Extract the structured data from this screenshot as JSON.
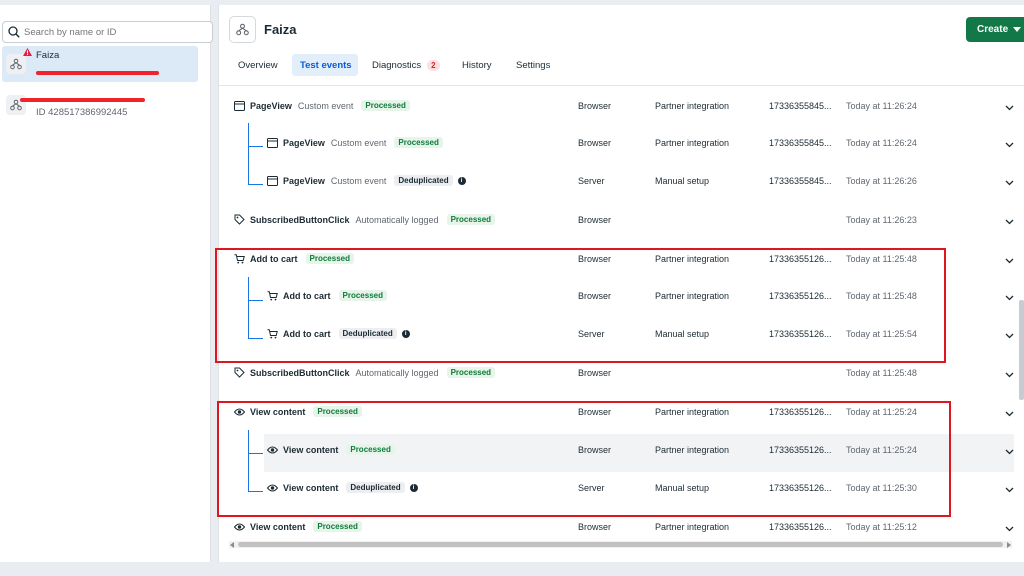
{
  "search": {
    "placeholder": "Search by name or ID"
  },
  "accounts": [
    {
      "name": "Faiza",
      "selected": true,
      "warning": true
    },
    {
      "name": "",
      "id_line": "ID 428517386992445",
      "selected": false
    }
  ],
  "header": {
    "title": "Faiza",
    "create_label": "Create"
  },
  "tabs": [
    {
      "label": "Overview",
      "active": false
    },
    {
      "label": "Test events",
      "active": true
    },
    {
      "label": "Diagnostics",
      "active": false,
      "count": "2"
    },
    {
      "label": "History",
      "active": false
    },
    {
      "label": "Settings",
      "active": false
    }
  ],
  "events": [
    {
      "icon": "browser-window-icon",
      "name": "PageView",
      "type": "Custom event",
      "status": "Processed",
      "source": "Browser",
      "setup": "Partner integration",
      "event_id": "17336355845...",
      "time": "Today at 11:26:24",
      "child": false
    },
    {
      "icon": "browser-window-icon",
      "name": "PageView",
      "type": "Custom event",
      "status": "Processed",
      "source": "Browser",
      "setup": "Partner integration",
      "event_id": "17336355845...",
      "time": "Today at 11:26:24",
      "child": true
    },
    {
      "icon": "browser-window-icon",
      "name": "PageView",
      "type": "Custom event",
      "status": "Deduplicated",
      "info": true,
      "source": "Server",
      "setup": "Manual setup",
      "event_id": "17336355845...",
      "time": "Today at 11:26:26",
      "child": true
    },
    {
      "icon": "tag-icon",
      "name": "SubscribedButtonClick",
      "type": "Automatically logged",
      "status": "Processed",
      "source": "Browser",
      "setup": "",
      "event_id": "",
      "time": "Today at 11:26:23",
      "child": false
    },
    {
      "icon": "cart-icon",
      "name": "Add to cart",
      "type": "",
      "status": "Processed",
      "source": "Browser",
      "setup": "Partner integration",
      "event_id": "17336355126...",
      "time": "Today at 11:25:48",
      "child": false
    },
    {
      "icon": "cart-icon",
      "name": "Add to cart",
      "type": "",
      "status": "Processed",
      "source": "Browser",
      "setup": "Partner integration",
      "event_id": "17336355126...",
      "time": "Today at 11:25:48",
      "child": true
    },
    {
      "icon": "cart-icon",
      "name": "Add to cart",
      "type": "",
      "status": "Deduplicated",
      "info": true,
      "source": "Server",
      "setup": "Manual setup",
      "event_id": "17336355126...",
      "time": "Today at 11:25:54",
      "child": true
    },
    {
      "icon": "tag-icon",
      "name": "SubscribedButtonClick",
      "type": "Automatically logged",
      "status": "Processed",
      "source": "Browser",
      "setup": "",
      "event_id": "",
      "time": "Today at 11:25:48",
      "child": false
    },
    {
      "icon": "eye-icon",
      "name": "View content",
      "type": "",
      "status": "Processed",
      "source": "Browser",
      "setup": "Partner integration",
      "event_id": "17336355126...",
      "time": "Today at 11:25:24",
      "child": false
    },
    {
      "icon": "eye-icon",
      "name": "View content",
      "type": "",
      "status": "Processed",
      "source": "Browser",
      "setup": "Partner integration",
      "event_id": "17336355126...",
      "time": "Today at 11:25:24",
      "child": true,
      "highlighted": true
    },
    {
      "icon": "eye-icon",
      "name": "View content",
      "type": "",
      "status": "Deduplicated",
      "info": true,
      "source": "Server",
      "setup": "Manual setup",
      "event_id": "17336355126...",
      "time": "Today at 11:25:30",
      "child": true
    },
    {
      "icon": "eye-icon",
      "name": "View content",
      "type": "",
      "status": "Processed",
      "source": "Browser",
      "setup": "Partner integration",
      "event_id": "17336355126...",
      "time": "Today at 11:25:12",
      "child": false
    }
  ],
  "colors": {
    "accent": "#0b5cd5",
    "create": "#127848",
    "annotation": "#e0161e",
    "processed": "#0f7b3b"
  }
}
